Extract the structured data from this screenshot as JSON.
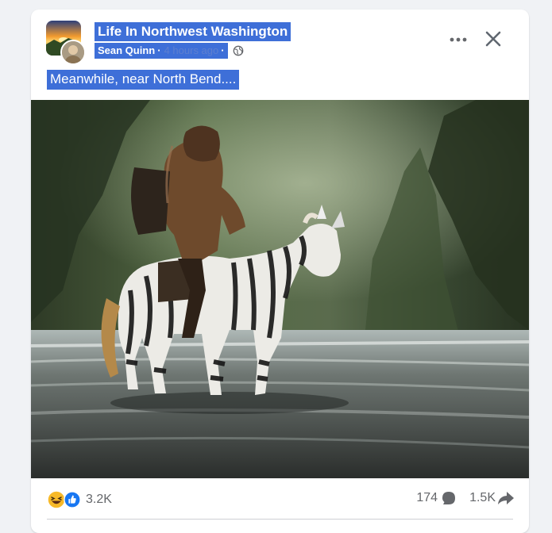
{
  "post": {
    "group_name": "Life In Northwest Washington",
    "author": "Sean Quinn",
    "time": "4 hours ago",
    "text": "Meanwhile, near North Bend...."
  },
  "footer": {
    "reaction_count": "3.2K",
    "comment_count": "174",
    "share_count": "1.5K"
  },
  "icons": {
    "more": "more-options-icon",
    "close": "close-icon",
    "privacy": "globe-icon",
    "haha": "haha-reaction-icon",
    "like": "like-reaction-icon",
    "comment": "comment-icon",
    "share": "share-icon"
  },
  "colors": {
    "selection_highlight": "#3e6fd8",
    "like_blue": "#1877f2",
    "secondary_text": "#65676b"
  }
}
